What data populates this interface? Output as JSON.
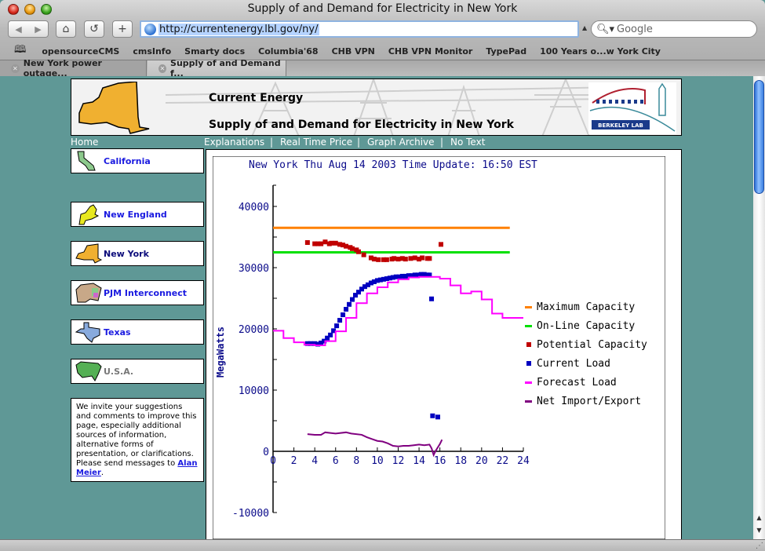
{
  "browser": {
    "window_title": "Supply of and Demand for Electricity in New York",
    "url": "http://currentenergy.lbl.gov/ny/",
    "search_placeholder": "Google",
    "bookmarks": [
      "opensourceCMS",
      "cmsInfo",
      "Smarty docs",
      "Columbia'68",
      "CHB VPN",
      "CHB VPN Monitor",
      "TypePad",
      "100 Years o...w York City"
    ],
    "tabs": [
      {
        "label": "New York power outage...",
        "active": false
      },
      {
        "label": "Supply of and Demand f...",
        "active": true
      }
    ],
    "icons": {
      "back": "back-arrow-icon",
      "forward": "forward-arrow-icon",
      "home": "home-icon",
      "reload": "reload-icon",
      "add": "plus-icon",
      "search": "magnifier-icon",
      "bookmarks": "book-icon"
    }
  },
  "banner": {
    "title": "Current Energy",
    "subtitle": "Supply of and Demand for Electricity in New York",
    "logo_text": "BERKELEY LAB"
  },
  "menu": {
    "home": "Home",
    "items": [
      "Explanations",
      "Real Time Price",
      "Graph Archive",
      "No Text"
    ],
    "separator": "|"
  },
  "sidebar": {
    "regions": [
      {
        "label": "California",
        "color": "#8cc98c",
        "state": "link"
      },
      {
        "label": "New England",
        "color": "#e8e820",
        "state": "link"
      },
      {
        "label": "New York",
        "color": "#f0b030",
        "state": "current"
      },
      {
        "label": "PJM Interconnect",
        "color": "#c8a888",
        "state": "link"
      },
      {
        "label": "Texas",
        "color": "#88aadd",
        "state": "link"
      },
      {
        "label": "U.S.A.",
        "color": "#55b055",
        "state": "disabled"
      }
    ],
    "note_text": "We invite your suggestions and comments to improve this page, especially additional sources of information, alternative forms of presentation, or clarifications. Please send messages to ",
    "note_link": "Alan Meier",
    "note_end": "."
  },
  "chart_data": {
    "type": "line",
    "title": "New York Thu Aug 14 2003 Time Update: 16:50 EST",
    "xlabel": "",
    "ylabel": "MegaWatts",
    "xlim": [
      0,
      24
    ],
    "ylim": [
      -12000,
      45000
    ],
    "x_ticks": [
      0,
      2,
      4,
      6,
      8,
      10,
      12,
      14,
      16,
      18,
      20,
      22,
      24
    ],
    "y_ticks": [
      -10000,
      0,
      10000,
      20000,
      30000,
      40000
    ],
    "grid": false,
    "legend_position": "right",
    "series": [
      {
        "name": "Maximum Capacity",
        "color": "#ff8000",
        "style": "line",
        "x": [
          0,
          22.7
        ],
        "y": [
          36500,
          36500
        ]
      },
      {
        "name": "On-Line Capacity",
        "color": "#00e000",
        "style": "line",
        "x": [
          0,
          22.7
        ],
        "y": [
          32500,
          32500
        ]
      },
      {
        "name": "Potential Capacity",
        "color": "#c00000",
        "style": "markers",
        "x": [
          3.3,
          4.0,
          4.3,
          4.6,
          5.0,
          5.4,
          5.6,
          6.0,
          6.4,
          6.7,
          7.0,
          7.4,
          7.6,
          8.0,
          8.2,
          8.7,
          9.4,
          9.7,
          10.1,
          10.6,
          10.9,
          11.4,
          11.6,
          12.0,
          12.4,
          12.7,
          13.2,
          13.6,
          14.0,
          14.3,
          14.8,
          15.0,
          16.1
        ],
        "y": [
          34100,
          33900,
          33900,
          33900,
          34200,
          33900,
          34000,
          34000,
          33800,
          33700,
          33500,
          33300,
          33100,
          32900,
          32600,
          32100,
          31600,
          31400,
          31300,
          31300,
          31300,
          31400,
          31500,
          31400,
          31500,
          31400,
          31500,
          31600,
          31400,
          31600,
          31500,
          31500,
          33800
        ]
      },
      {
        "name": "Current Load",
        "color": "#0000c0",
        "style": "markers",
        "x": [
          3.3,
          3.6,
          4.0,
          4.3,
          4.6,
          4.9,
          5.2,
          5.5,
          5.8,
          6.1,
          6.4,
          6.7,
          7.0,
          7.3,
          7.6,
          7.9,
          8.2,
          8.5,
          8.8,
          9.1,
          9.4,
          9.7,
          10.0,
          10.3,
          10.6,
          10.9,
          11.2,
          11.5,
          11.8,
          12.1,
          12.4,
          12.7,
          13.0,
          13.3,
          13.6,
          13.9,
          14.2,
          14.5,
          14.8,
          15.0,
          15.2,
          15.3,
          15.8
        ],
        "y": [
          17600,
          17600,
          17600,
          17500,
          17700,
          18000,
          18500,
          19000,
          19700,
          20500,
          21400,
          22300,
          23200,
          24000,
          24800,
          25500,
          26000,
          26500,
          26900,
          27200,
          27500,
          27700,
          27900,
          28000,
          28100,
          28200,
          28300,
          28400,
          28500,
          28500,
          28600,
          28600,
          28700,
          28700,
          28800,
          28800,
          28900,
          28900,
          28800,
          28800,
          24900,
          5800,
          5600
        ]
      },
      {
        "name": "Forecast Load",
        "color": "#ff00ff",
        "style": "step",
        "x": [
          0,
          1,
          2,
          3,
          4,
          5,
          6,
          7,
          8,
          9,
          10,
          11,
          12,
          13,
          14,
          15,
          16,
          17,
          18,
          19,
          20,
          21,
          22,
          23
        ],
        "y": [
          19700,
          18500,
          17800,
          17400,
          17300,
          18000,
          19600,
          21800,
          24200,
          25800,
          26800,
          27600,
          28100,
          28400,
          28500,
          28500,
          28200,
          27100,
          25800,
          26100,
          24800,
          22500,
          21800,
          21800
        ]
      },
      {
        "name": "Net Import/Export",
        "color": "#800080",
        "style": "line",
        "x": [
          3.3,
          4.0,
          4.6,
          5.0,
          5.5,
          6.0,
          7.0,
          7.5,
          8.5,
          9.0,
          9.5,
          10.0,
          10.5,
          11.0,
          11.5,
          12.0,
          12.5,
          13.0,
          13.5,
          14.0,
          14.5,
          15.0,
          15.2,
          15.4,
          15.6,
          16.0,
          16.2
        ],
        "y": [
          2800,
          2700,
          2700,
          3100,
          3000,
          2900,
          3100,
          2900,
          2700,
          2300,
          2000,
          1700,
          1600,
          1300,
          900,
          800,
          900,
          900,
          1000,
          1100,
          1000,
          1100,
          500,
          -600,
          100,
          1200,
          1900
        ]
      }
    ]
  }
}
